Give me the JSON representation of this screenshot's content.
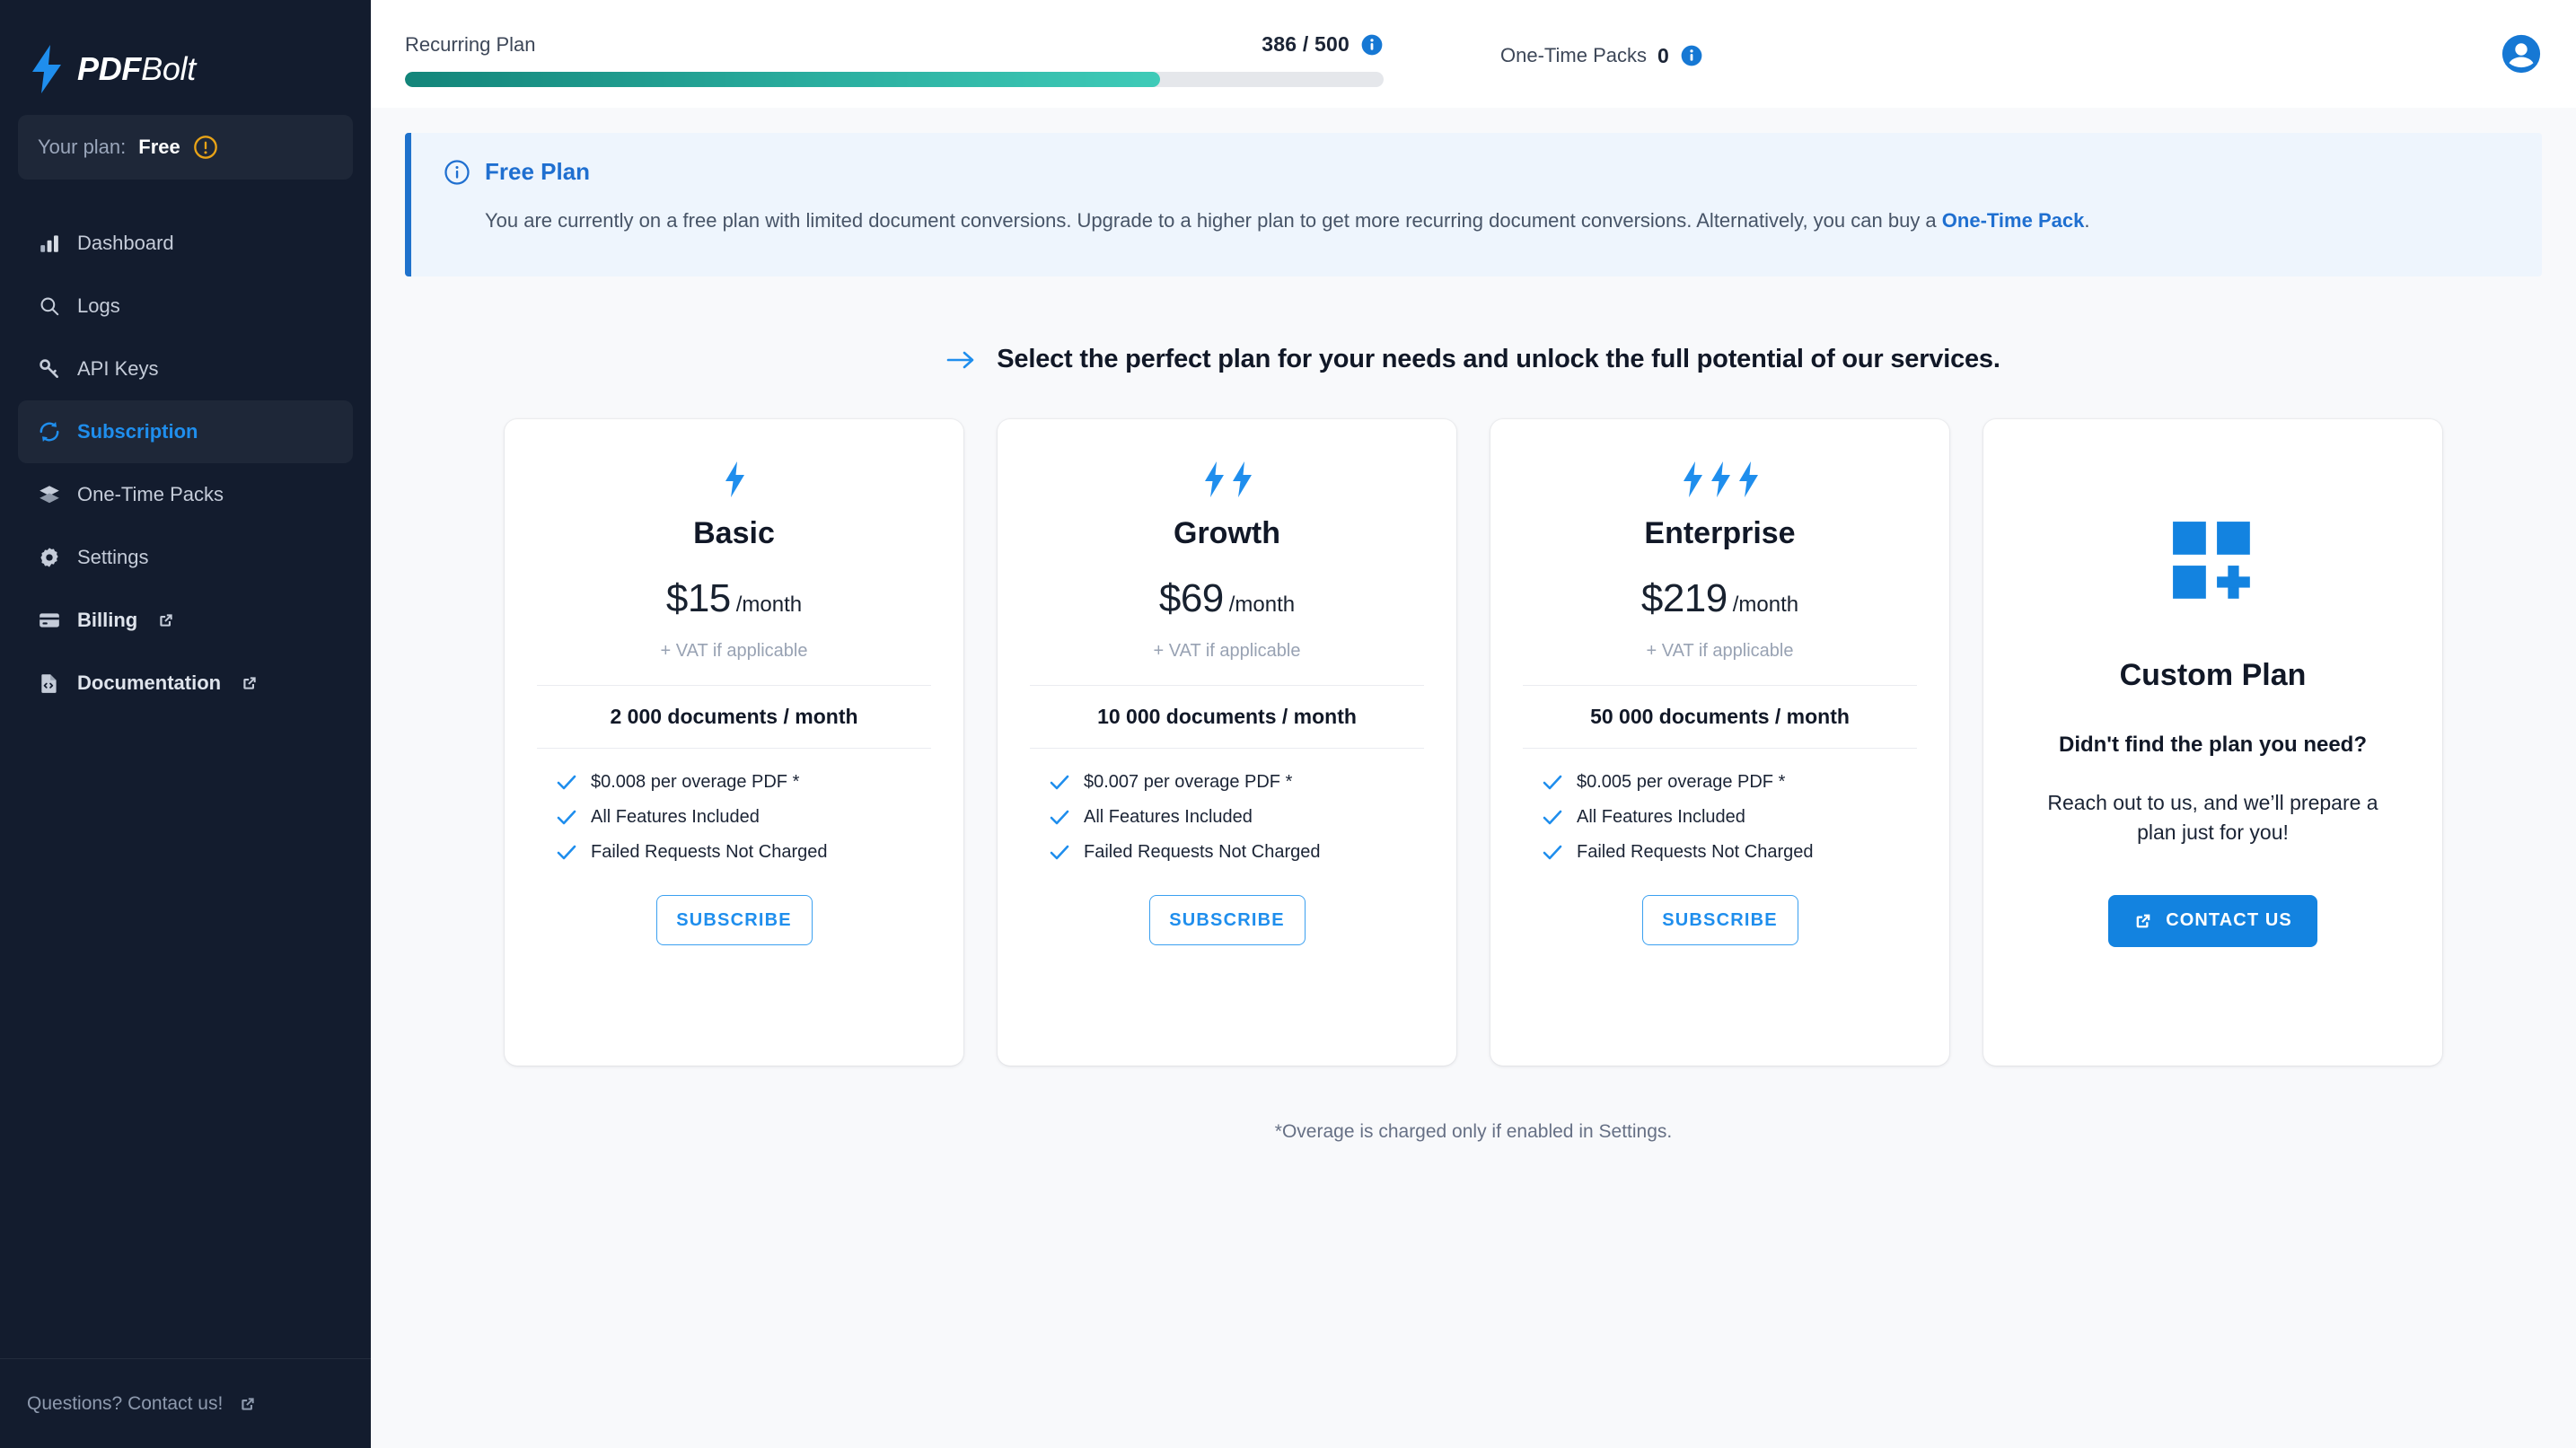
{
  "brand": {
    "name_bold": "PDF",
    "name_light": "Bolt",
    "logo_icon": "lightning-bolt-icon"
  },
  "sidebar": {
    "plan_chip": {
      "label": "Your plan:",
      "value": "Free",
      "icon": "alert-circle-icon",
      "icon_color": "#e8a317"
    },
    "items": [
      {
        "label": "Dashboard",
        "icon": "bar-chart-icon",
        "active": false,
        "external": false
      },
      {
        "label": "Logs",
        "icon": "search-icon",
        "active": false,
        "external": false
      },
      {
        "label": "API Keys",
        "icon": "key-icon",
        "active": false,
        "external": false
      },
      {
        "label": "Subscription",
        "icon": "refresh-icon",
        "active": true,
        "external": false
      },
      {
        "label": "One-Time Packs",
        "icon": "layers-icon",
        "active": false,
        "external": false
      },
      {
        "label": "Settings",
        "icon": "gear-icon",
        "active": false,
        "external": false
      },
      {
        "label": "Billing",
        "icon": "credit-card-icon",
        "active": false,
        "external": true
      },
      {
        "label": "Documentation",
        "icon": "document-code-icon",
        "active": false,
        "external": true
      }
    ],
    "footer": {
      "label": "Questions? Contact us!",
      "icon": "external-link-icon"
    }
  },
  "topbar": {
    "recurring": {
      "label": "Recurring Plan",
      "count_text": "386 / 500",
      "used": 386,
      "limit": 500,
      "percent": 77.2,
      "info_icon": "info-circle-icon",
      "fill_from": "#13857a",
      "fill_to": "#3fcbb8"
    },
    "one_time": {
      "label": "One-Time Packs",
      "count_text": "0",
      "info_icon": "info-circle-icon"
    },
    "avatar_icon": "account-circle-icon"
  },
  "notice": {
    "icon": "info-circle-outline-icon",
    "title": "Free Plan",
    "body_before": "You are currently on a free plan with limited document conversions. Upgrade to a higher plan to get more recurring document conversions. Alternatively, you can buy a ",
    "link_text": "One-Time Pack",
    "body_after": ".",
    "accent": "#1f72cc"
  },
  "headline": {
    "icon": "arrow-right-icon",
    "text": "Select the perfect plan for your needs and unlock the full potential of our services."
  },
  "plans": [
    {
      "name": "Basic",
      "bolts": 1,
      "price_amount": "$15",
      "price_period": "/month",
      "vat_note": "+ VAT if applicable",
      "quota": "2 000 documents / month",
      "features": [
        "$0.008 per overage PDF *",
        "All Features Included",
        "Failed Requests Not Charged"
      ],
      "cta": "SUBSCRIBE"
    },
    {
      "name": "Growth",
      "bolts": 2,
      "price_amount": "$69",
      "price_period": "/month",
      "vat_note": "+ VAT if applicable",
      "quota": "10 000 documents / month",
      "features": [
        "$0.007 per overage PDF *",
        "All Features Included",
        "Failed Requests Not Charged"
      ],
      "cta": "SUBSCRIBE"
    },
    {
      "name": "Enterprise",
      "bolts": 3,
      "price_amount": "$219",
      "price_period": "/month",
      "vat_note": "+ VAT if applicable",
      "quota": "50 000 documents / month",
      "features": [
        "$0.005 per overage PDF *",
        "All Features Included",
        "Failed Requests Not Charged"
      ],
      "cta": "SUBSCRIBE"
    }
  ],
  "custom_plan": {
    "icon": "grid-plus-icon",
    "title": "Custom Plan",
    "subtitle": "Didn't find the plan you need?",
    "text": "Reach out to us, and we’ll prepare a plan just for you!",
    "cta": "CONTACT US",
    "cta_icon": "external-link-icon"
  },
  "footnote": "*Overage is charged only if enabled in Settings.",
  "colors": {
    "accent_blue": "#1f8eed",
    "brand_blue": "#1383e0",
    "sidebar_bg": "#131c2e",
    "page_bg": "#f8f9fb"
  }
}
